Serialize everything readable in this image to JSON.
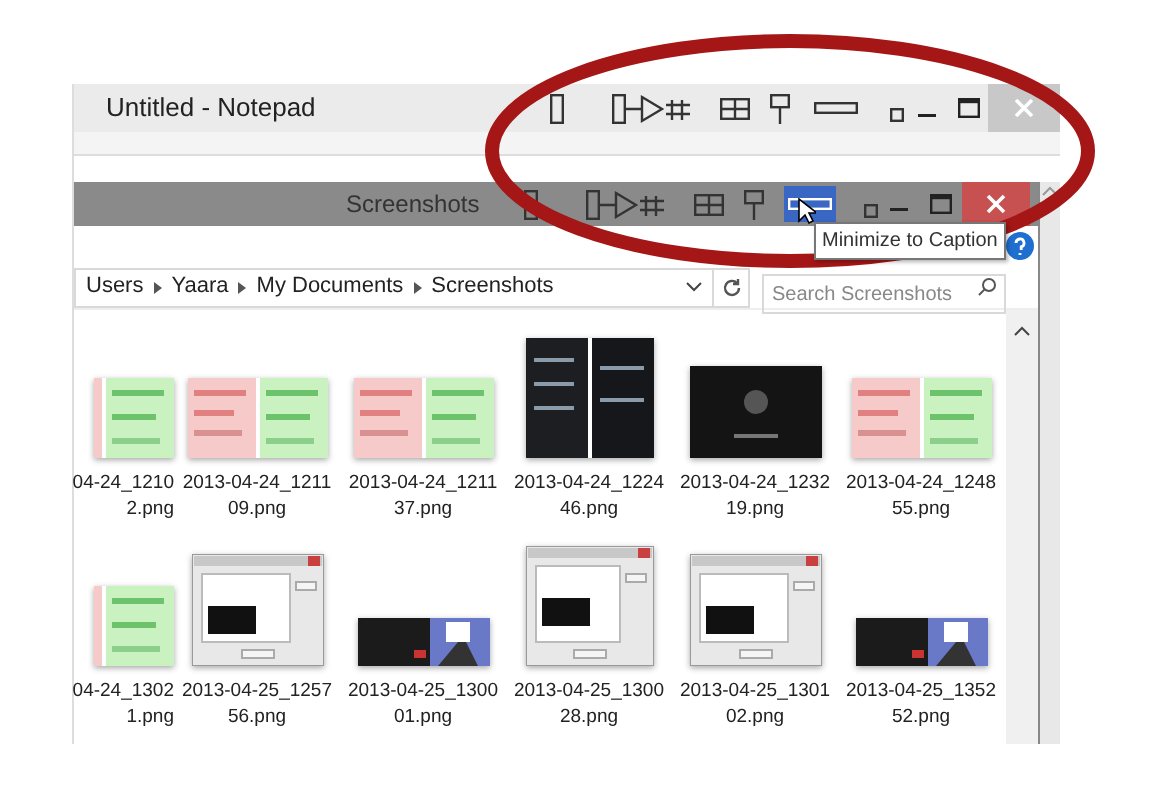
{
  "notepad": {
    "title": "Untitled - Notepad"
  },
  "explorer": {
    "title": "Screenshots",
    "caption_button_hovered": true,
    "tooltip": "Minimize to Caption",
    "breadcrumb": [
      "Users",
      "Yaara",
      "My Documents",
      "Screenshots"
    ],
    "search": {
      "placeholder": "Search Screenshots"
    },
    "files": [
      {
        "name_lines": [
          "04-24_1210",
          "2.png"
        ],
        "kind": "diff",
        "cut": true
      },
      {
        "name_lines": [
          "2013-04-24_1211",
          "09.png"
        ],
        "kind": "diff"
      },
      {
        "name_lines": [
          "2013-04-24_1211",
          "37.png"
        ],
        "kind": "diff"
      },
      {
        "name_lines": [
          "2013-04-24_1224",
          "46.png"
        ],
        "kind": "phone"
      },
      {
        "name_lines": [
          "2013-04-24_1232",
          "19.png"
        ],
        "kind": "dark"
      },
      {
        "name_lines": [
          "2013-04-24_1248",
          "55.png"
        ],
        "kind": "diff"
      },
      {
        "name_lines": [
          "04-24_1302",
          "1.png"
        ],
        "kind": "diff",
        "cut": true
      },
      {
        "name_lines": [
          "2013-04-25_1257",
          "56.png"
        ],
        "kind": "dialog"
      },
      {
        "name_lines": [
          "2013-04-25_1300",
          "01.png"
        ],
        "kind": "desktop"
      },
      {
        "name_lines": [
          "2013-04-25_1300",
          "28.png"
        ],
        "kind": "tall-dialog"
      },
      {
        "name_lines": [
          "2013-04-25_1301",
          "02.png"
        ],
        "kind": "dialog"
      },
      {
        "name_lines": [
          "2013-04-25_1352",
          "52.png"
        ],
        "kind": "desktop"
      }
    ]
  }
}
